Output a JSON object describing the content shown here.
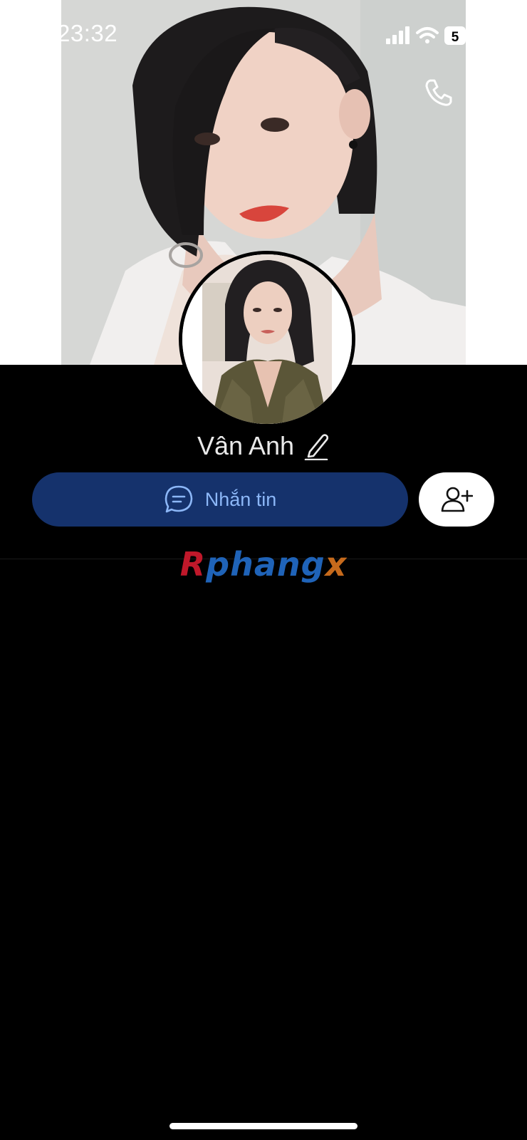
{
  "status_bar": {
    "time": "23:32",
    "battery_text": "5"
  },
  "nav": {
    "back_icon": "chevron-left-icon",
    "call_icon": "phone-icon",
    "more_icon": "more-dots-icon"
  },
  "profile": {
    "name": "Vân Anh",
    "edit_icon": "pencil-icon"
  },
  "actions": {
    "message_label": "Nhắn tin",
    "message_icon": "chat-bubble-icon",
    "add_friend_icon": "add-friend-icon"
  },
  "watermark": {
    "part1": "R",
    "part2": "phang",
    "part3": "x"
  },
  "colors": {
    "message_button_bg": "#15326c",
    "message_text": "#8cb7f7",
    "background": "#000000"
  }
}
